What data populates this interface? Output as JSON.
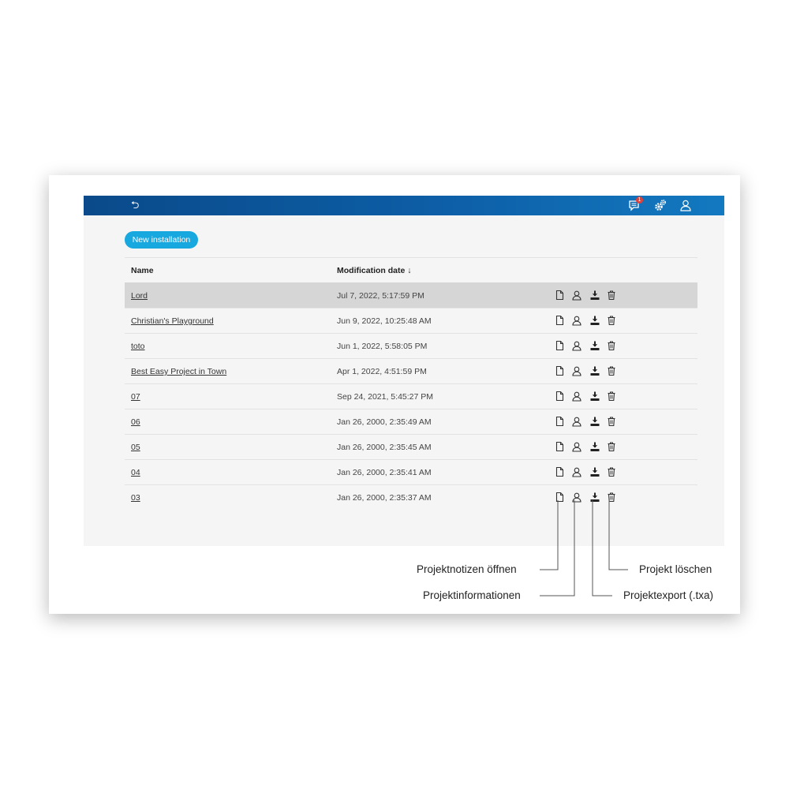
{
  "topbar": {
    "back_icon": "undo-arrow-icon",
    "back_glyph": "⮌",
    "notification_icon": "chat-bubble-icon",
    "notification_count": "1",
    "settings_icon": "gears-icon",
    "user_icon": "user-icon"
  },
  "toolbar": {
    "new_installation_label": "New installation"
  },
  "table": {
    "columns": {
      "name": "Name",
      "modification_date": "Modification date ↓"
    },
    "rows": [
      {
        "name": "Lord",
        "date": "Jul 7, 2022, 5:17:59 PM",
        "selected": true
      },
      {
        "name": "Christian's Playground",
        "date": "Jun 9, 2022, 10:25:48 AM"
      },
      {
        "name": "toto",
        "date": "Jun 1, 2022, 5:58:05 PM"
      },
      {
        "name": "Best Easy Project in Town",
        "date": "Apr 1, 2022, 4:51:59 PM"
      },
      {
        "name": "07",
        "date": "Sep 24, 2021, 5:45:27 PM"
      },
      {
        "name": "06",
        "date": "Jan 26, 2000, 2:35:49 AM"
      },
      {
        "name": "05",
        "date": "Jan 26, 2000, 2:35:45 AM"
      },
      {
        "name": "04",
        "date": "Jan 26, 2000, 2:35:41 AM"
      },
      {
        "name": "03",
        "date": "Jan 26, 2000, 2:35:37 AM"
      }
    ],
    "row_action_icons": [
      "document-icon",
      "user-icon",
      "download-icon",
      "trash-icon"
    ]
  },
  "callouts": {
    "notes": "Projektnotizen öffnen",
    "info": "Projektinformationen",
    "delete": "Projekt löschen",
    "export": "Projektexport (.txa)"
  },
  "colors": {
    "topbar": "#0d5ea6",
    "button": "#18a8e0",
    "selected_row": "#d6d6d6",
    "badge": "#e0403a"
  }
}
